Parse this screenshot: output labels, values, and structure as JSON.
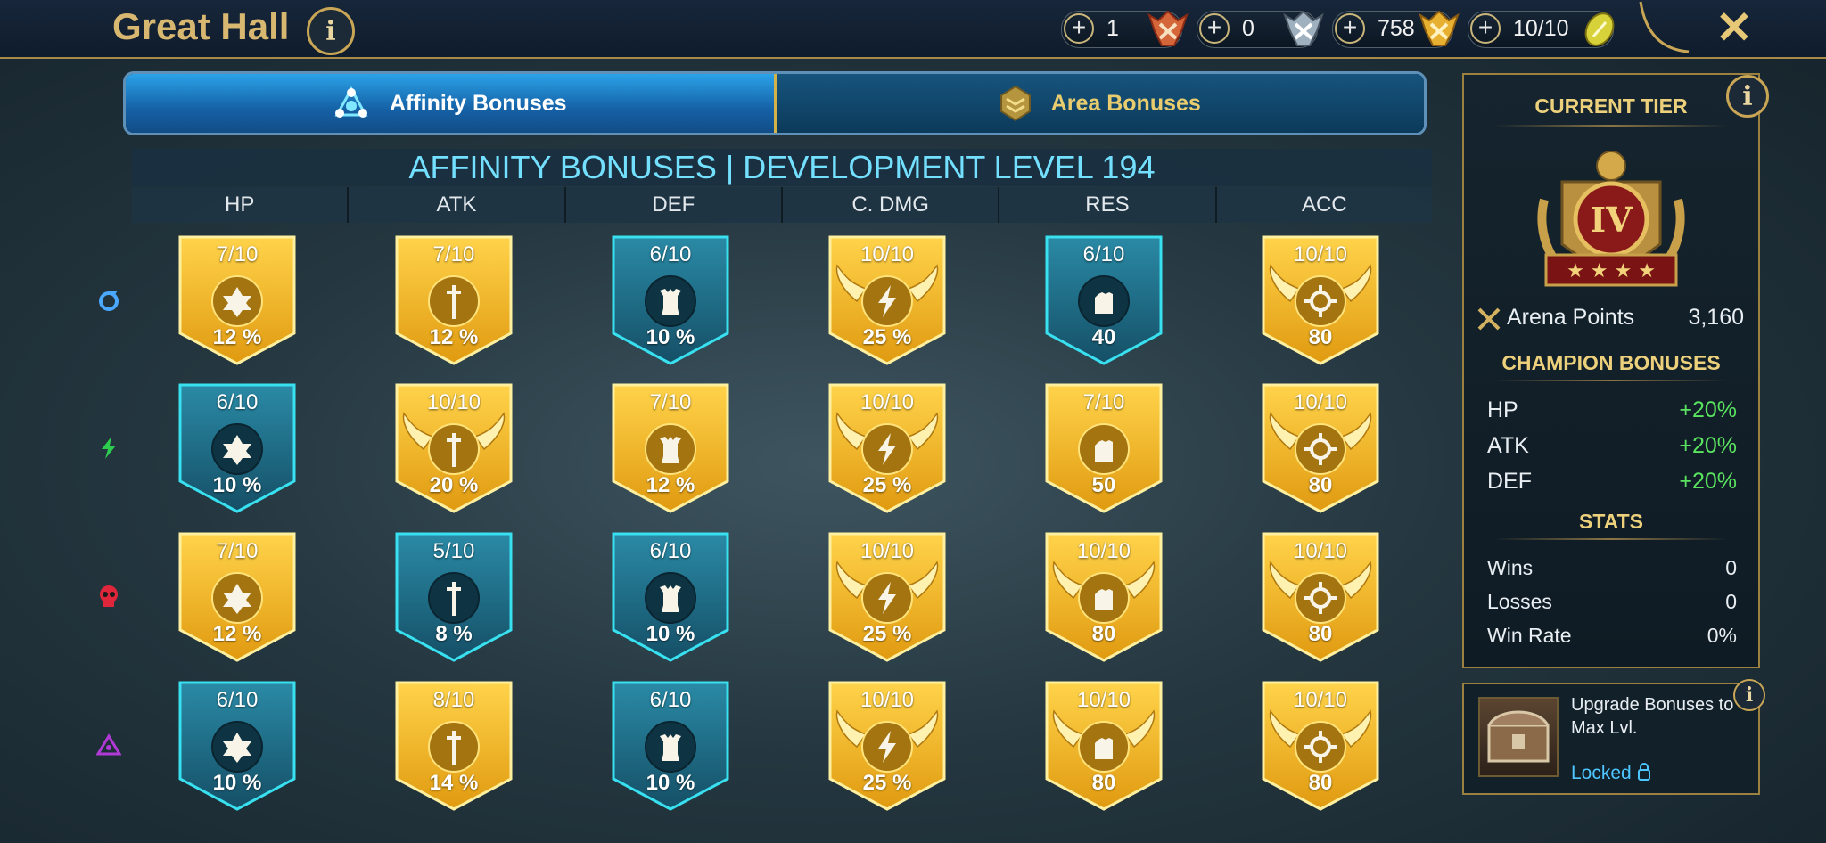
{
  "topbar": {
    "title": "Great Hall",
    "resources": [
      {
        "value": "1",
        "icon": "red-emblem-icon"
      },
      {
        "value": "0",
        "icon": "silver-emblem-icon"
      },
      {
        "value": "758",
        "icon": "gold-emblem-icon"
      },
      {
        "value": "10/10",
        "icon": "arena-token-icon"
      }
    ]
  },
  "tabs": {
    "affinity": "Affinity Bonuses",
    "area": "Area Bonuses"
  },
  "table": {
    "heading": "AFFINITY BONUSES | DEVELOPMENT LEVEL 194",
    "columns": [
      "HP",
      "ATK",
      "DEF",
      "C. DMG",
      "RES",
      "ACC"
    ],
    "rows": [
      {
        "affinity": "magic",
        "color": "#4aa8ff",
        "cells": [
          {
            "level": "7/10",
            "bonus": "12 %",
            "tier": "gold"
          },
          {
            "level": "7/10",
            "bonus": "12 %",
            "tier": "gold"
          },
          {
            "level": "6/10",
            "bonus": "10 %",
            "tier": "teal"
          },
          {
            "level": "10/10",
            "bonus": "25 %",
            "tier": "max"
          },
          {
            "level": "6/10",
            "bonus": "40",
            "tier": "teal"
          },
          {
            "level": "10/10",
            "bonus": "80",
            "tier": "max"
          }
        ]
      },
      {
        "affinity": "spirit",
        "color": "#2ecc4e",
        "cells": [
          {
            "level": "6/10",
            "bonus": "10 %",
            "tier": "teal"
          },
          {
            "level": "10/10",
            "bonus": "20 %",
            "tier": "max"
          },
          {
            "level": "7/10",
            "bonus": "12 %",
            "tier": "gold"
          },
          {
            "level": "10/10",
            "bonus": "25 %",
            "tier": "max"
          },
          {
            "level": "7/10",
            "bonus": "50",
            "tier": "gold"
          },
          {
            "level": "10/10",
            "bonus": "80",
            "tier": "max"
          }
        ]
      },
      {
        "affinity": "force",
        "color": "#e0263a",
        "cells": [
          {
            "level": "7/10",
            "bonus": "12 %",
            "tier": "gold"
          },
          {
            "level": "5/10",
            "bonus": "8 %",
            "tier": "teal"
          },
          {
            "level": "6/10",
            "bonus": "10 %",
            "tier": "teal"
          },
          {
            "level": "10/10",
            "bonus": "25 %",
            "tier": "max"
          },
          {
            "level": "10/10",
            "bonus": "80",
            "tier": "max"
          },
          {
            "level": "10/10",
            "bonus": "80",
            "tier": "max"
          }
        ]
      },
      {
        "affinity": "void",
        "color": "#b13ad6",
        "cells": [
          {
            "level": "6/10",
            "bonus": "10 %",
            "tier": "teal"
          },
          {
            "level": "8/10",
            "bonus": "14 %",
            "tier": "gold"
          },
          {
            "level": "6/10",
            "bonus": "10 %",
            "tier": "teal"
          },
          {
            "level": "10/10",
            "bonus": "25 %",
            "tier": "max"
          },
          {
            "level": "10/10",
            "bonus": "80",
            "tier": "max"
          },
          {
            "level": "10/10",
            "bonus": "80",
            "tier": "max"
          }
        ]
      }
    ]
  },
  "panel": {
    "current_tier_title": "CURRENT TIER",
    "tier_numeral": "IV",
    "arena_points_label": "Arena Points",
    "arena_points_value": "3,160",
    "champion_bonuses_title": "CHAMPION BONUSES",
    "champion_bonuses": [
      {
        "stat": "HP",
        "value": "+20%"
      },
      {
        "stat": "ATK",
        "value": "+20%"
      },
      {
        "stat": "DEF",
        "value": "+20%"
      }
    ],
    "stats_title": "STATS",
    "stats": [
      {
        "label": "Wins",
        "value": "0"
      },
      {
        "label": "Losses",
        "value": "0"
      },
      {
        "label": "Win Rate",
        "value": "0%"
      }
    ]
  },
  "upgrade": {
    "text": "Upgrade Bonuses to Max Lvl.",
    "status": "Locked"
  },
  "colors": {
    "gold": "#f0b82a",
    "teal": "#1f6d86",
    "teal_border": "#38e0f0",
    "accent": "#ecd07b",
    "positive": "#59e35f"
  }
}
